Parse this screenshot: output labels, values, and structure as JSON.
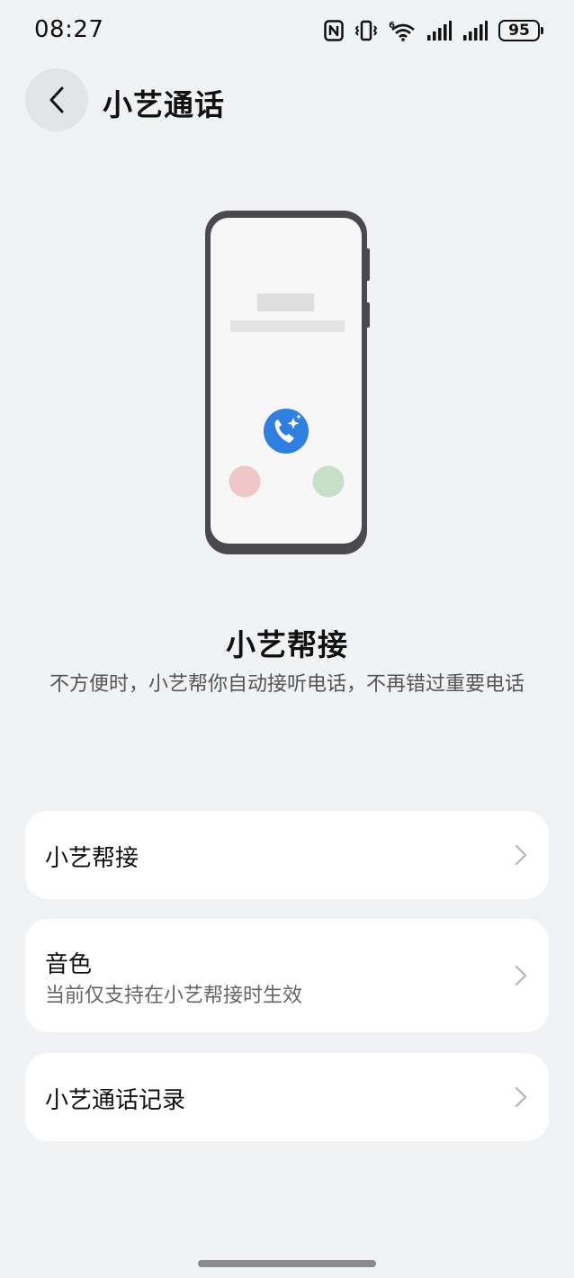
{
  "status_bar": {
    "time": "08:27",
    "battery_level": "95",
    "icons": [
      "nfc-icon",
      "vibrate-icon",
      "wifi-6-icon",
      "signal-icon",
      "signal-icon",
      "battery-icon"
    ]
  },
  "header": {
    "title": "小艺通话",
    "back_icon": "chevron-left-icon"
  },
  "intro": {
    "title": "小艺帮接",
    "description": "不方便时，小艺帮你自动接听电话，不再错过重要电话"
  },
  "settings": {
    "items": [
      {
        "label": "小艺帮接",
        "subtitle": ""
      },
      {
        "label": "音色",
        "subtitle": "当前仅支持在小艺帮接时生效"
      },
      {
        "label": "小艺通话记录",
        "subtitle": ""
      }
    ]
  },
  "colors": {
    "background": "#f1f2f4",
    "card": "#ffffff",
    "accent_blue": "#2f7fe0",
    "decline_red": "#f1c6c6",
    "accept_green": "#c7dfc7"
  }
}
